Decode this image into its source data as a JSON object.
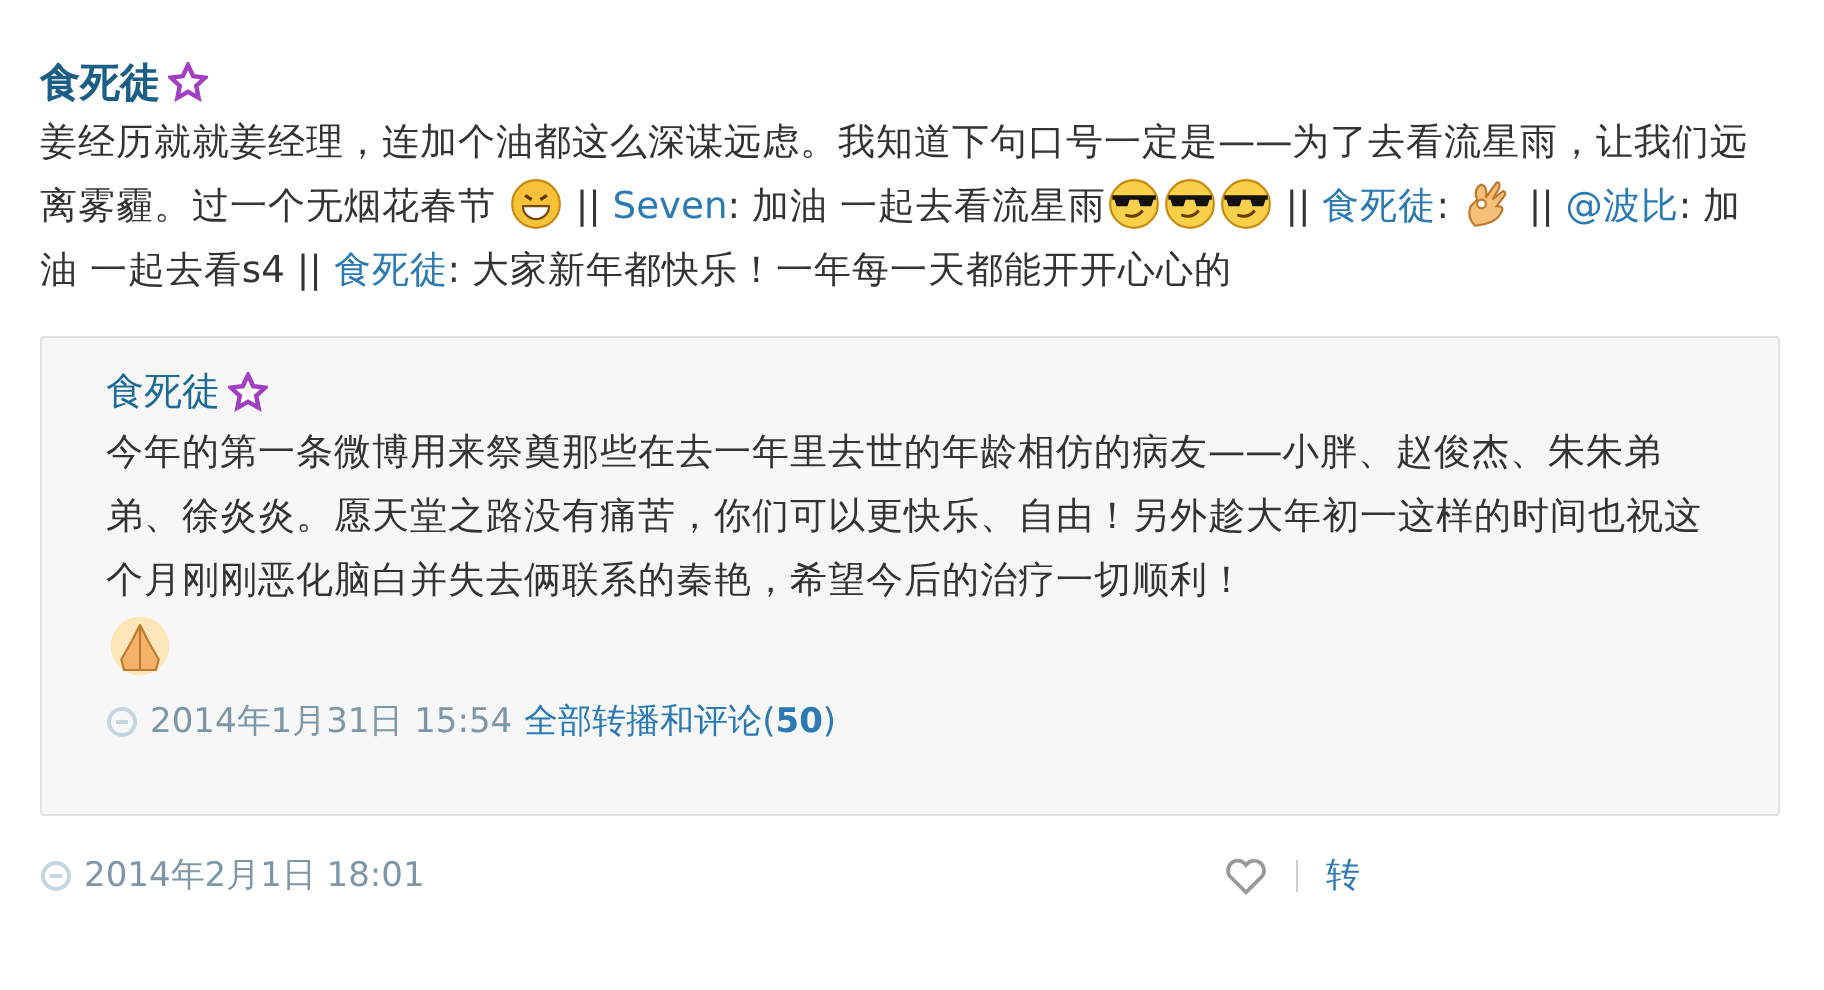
{
  "post": {
    "author": "食死徒",
    "body": [
      {
        "kind": "text",
        "text": "姜经历就就姜经理，连加个油都这么深谋远虑。我知道下句口号一定是——为了去看流星雨，让我们远离雾霾。过一个无烟花春节 "
      },
      {
        "kind": "grin"
      },
      {
        "kind": "text",
        "text": " || "
      },
      {
        "kind": "link",
        "text": "Seven"
      },
      {
        "kind": "text",
        "text": ": 加油 一起去看流星雨"
      },
      {
        "kind": "cool"
      },
      {
        "kind": "cool"
      },
      {
        "kind": "cool"
      },
      {
        "kind": "text",
        "text": " || "
      },
      {
        "kind": "link",
        "text": "食死徒"
      },
      {
        "kind": "text",
        "text": ": "
      },
      {
        "kind": "ok"
      },
      {
        "kind": "text",
        "text": " || "
      },
      {
        "kind": "link",
        "text": "@波比"
      },
      {
        "kind": "text",
        "text": ": 加油 一起去看s4 || "
      },
      {
        "kind": "link",
        "text": "食死徒"
      },
      {
        "kind": "text",
        "text": ": 大家新年都快乐！一年每一天都能开开心心的"
      }
    ],
    "quote": {
      "author": "食死徒",
      "body": [
        {
          "kind": "text",
          "text": "今年的第一条微博用来祭奠那些在去一年里去世的年龄相仿的病友——小胖、赵俊杰、朱朱弟弟、徐炎炎。愿天堂之路没有痛苦，你们可以更快乐、自由！另外趁大年初一这样的时间也祝这个月刚刚恶化脑白并失去俩联系的秦艳，希望今后的治疗一切顺利！"
        },
        {
          "kind": "pray"
        }
      ],
      "time": "2014年1月31日 15:54",
      "link_text": "全部转播和评论(",
      "link_count": "50",
      "link_end": ")"
    },
    "time": "2014年2月1日 18:01",
    "repost": "转"
  }
}
